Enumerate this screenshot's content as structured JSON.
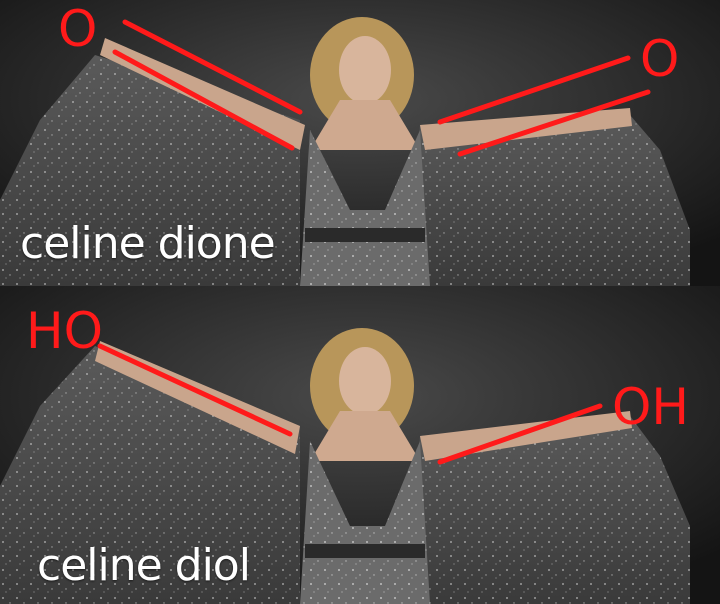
{
  "panels": [
    {
      "caption": "celine dione",
      "left_group": "O",
      "right_group": "O"
    },
    {
      "caption": "celine diol",
      "left_group": "HO",
      "right_group": "OH"
    }
  ],
  "colors": {
    "bond_line": "#ff1a1a",
    "caption_text": "#ffffff",
    "background": "#1a1a1a"
  }
}
